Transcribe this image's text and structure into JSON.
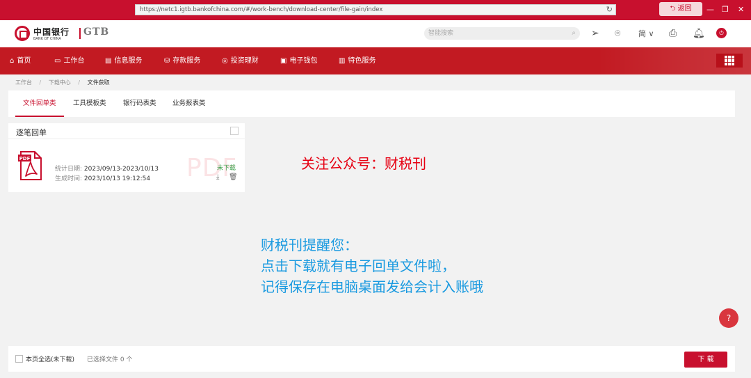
{
  "browser": {
    "url": "https://netc1.igtb.bankofchina.com/#/work-bench/download-center/file-gain/index",
    "back_label": "返回",
    "minimize": "—",
    "restore": "❐",
    "close": "✕",
    "reload": "↻"
  },
  "header": {
    "logo_cn": "中国银行",
    "logo_en": "BANK OF CHINA",
    "logo_gtb": "GTB",
    "search_placeholder": "智能搜索",
    "language": "简",
    "logout_glyph": "⏻"
  },
  "nav": {
    "items": [
      {
        "label": "首页",
        "icon": "home-icon",
        "glyph": "⌂"
      },
      {
        "label": "工作台",
        "icon": "workbench-icon",
        "glyph": "▭"
      },
      {
        "label": "信息服务",
        "icon": "info-icon",
        "glyph": "▤"
      },
      {
        "label": "存款服务",
        "icon": "deposit-icon",
        "glyph": "⛁"
      },
      {
        "label": "投资理财",
        "icon": "investment-icon",
        "glyph": "◎"
      },
      {
        "label": "电子钱包",
        "icon": "wallet-icon",
        "glyph": "▣"
      },
      {
        "label": "特色服务",
        "icon": "special-service-icon",
        "glyph": "▥"
      }
    ]
  },
  "breadcrumb": {
    "items": [
      "工作台",
      "下载中心",
      "文件获取"
    ],
    "separator": "/"
  },
  "tabs": [
    {
      "label": "文件回单类",
      "active": true
    },
    {
      "label": "工具模板类",
      "active": false
    },
    {
      "label": "银行码表类",
      "active": false
    },
    {
      "label": "业务报表类",
      "active": false
    }
  ],
  "list": {
    "title": "逐笔回单",
    "file": {
      "icon_text": "PDF",
      "watermark": "PDF",
      "period_label": "统计日期:",
      "period_value": "2023/09/13-2023/10/13",
      "generated_label": "生成时间:",
      "generated_value": "2023/10/13 19:12:54",
      "status": "未下载",
      "status_color": "#3aa049"
    }
  },
  "annotations": {
    "follow": "关注公众号：财税刊",
    "reminder_lines": [
      "财税刊提醒您：",
      "点击下载就有电子回单文件啦，",
      "记得保存在电脑桌面发给会计入账哦"
    ]
  },
  "help": {
    "label": "?"
  },
  "footer": {
    "select_all": "本页全选(未下载)",
    "selected_prefix": "已选择文件",
    "selected_count": "0",
    "selected_suffix": "个",
    "download_label": "下 载"
  },
  "colors": {
    "brand_red": "#c8102e",
    "nav_red": "#c21a22",
    "note_red": "#e60012",
    "note_blue": "#1a9ae0"
  }
}
